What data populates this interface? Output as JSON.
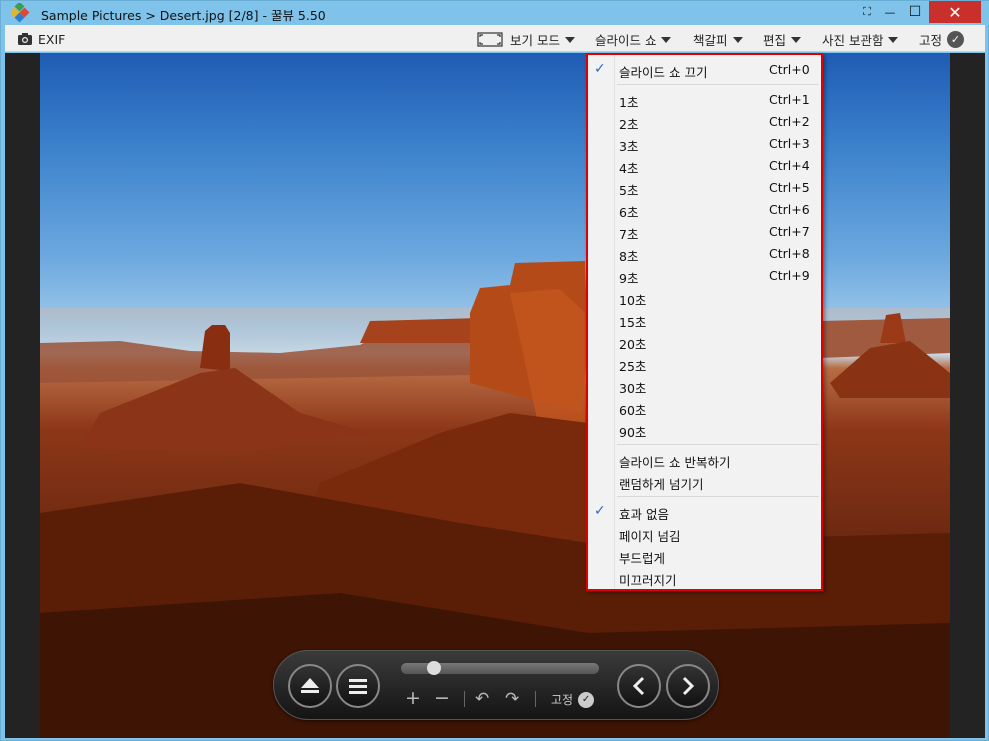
{
  "window": {
    "title": "Sample Pictures > Desert.jpg [2/8] - 꿀뷰 5.50",
    "controls": {
      "fullscreen": "⛶",
      "minimize": "—",
      "maximize": "☐",
      "close": "✕"
    }
  },
  "toolbar": {
    "exif_label": "EXIF",
    "view_mode_label": "보기 모드",
    "slideshow_label": "슬라이드 쇼",
    "bookmark_label": "책갈피",
    "edit_label": "편집",
    "album_label": "사진 보관함",
    "pin_label": "고정"
  },
  "slideshow_menu": {
    "items": [
      {
        "label": "슬라이드 쇼 끄기",
        "shortcut": "Ctrl+0",
        "checked": true
      },
      {
        "label": "1초",
        "shortcut": "Ctrl+1"
      },
      {
        "label": "2초",
        "shortcut": "Ctrl+2"
      },
      {
        "label": "3초",
        "shortcut": "Ctrl+3"
      },
      {
        "label": "4초",
        "shortcut": "Ctrl+4"
      },
      {
        "label": "5초",
        "shortcut": "Ctrl+5"
      },
      {
        "label": "6초",
        "shortcut": "Ctrl+6"
      },
      {
        "label": "7초",
        "shortcut": "Ctrl+7"
      },
      {
        "label": "8초",
        "shortcut": "Ctrl+8"
      },
      {
        "label": "9초",
        "shortcut": "Ctrl+9"
      },
      {
        "label": "10초",
        "shortcut": ""
      },
      {
        "label": "15초",
        "shortcut": ""
      },
      {
        "label": "20초",
        "shortcut": ""
      },
      {
        "label": "25초",
        "shortcut": ""
      },
      {
        "label": "30초",
        "shortcut": ""
      },
      {
        "label": "60초",
        "shortcut": ""
      },
      {
        "label": "90초",
        "shortcut": ""
      },
      {
        "label": "슬라이드 쇼 반복하기",
        "shortcut": ""
      },
      {
        "label": "랜덤하게 넘기기",
        "shortcut": ""
      },
      {
        "label": "효과 없음",
        "shortcut": "",
        "checked": true
      },
      {
        "label": "페이지 넘김",
        "shortcut": ""
      },
      {
        "label": "부드럽게",
        "shortcut": ""
      },
      {
        "label": "미끄러지기",
        "shortcut": ""
      }
    ],
    "check_glyph": "✓"
  },
  "control_bar": {
    "pin_label": "고정",
    "slider_position_fraction": 0.14
  },
  "colors": {
    "titlebar": "#7fc3ea",
    "close_button": "#c9302c",
    "menu_highlight_border": "#e00000",
    "check": "#2b6cc4"
  }
}
